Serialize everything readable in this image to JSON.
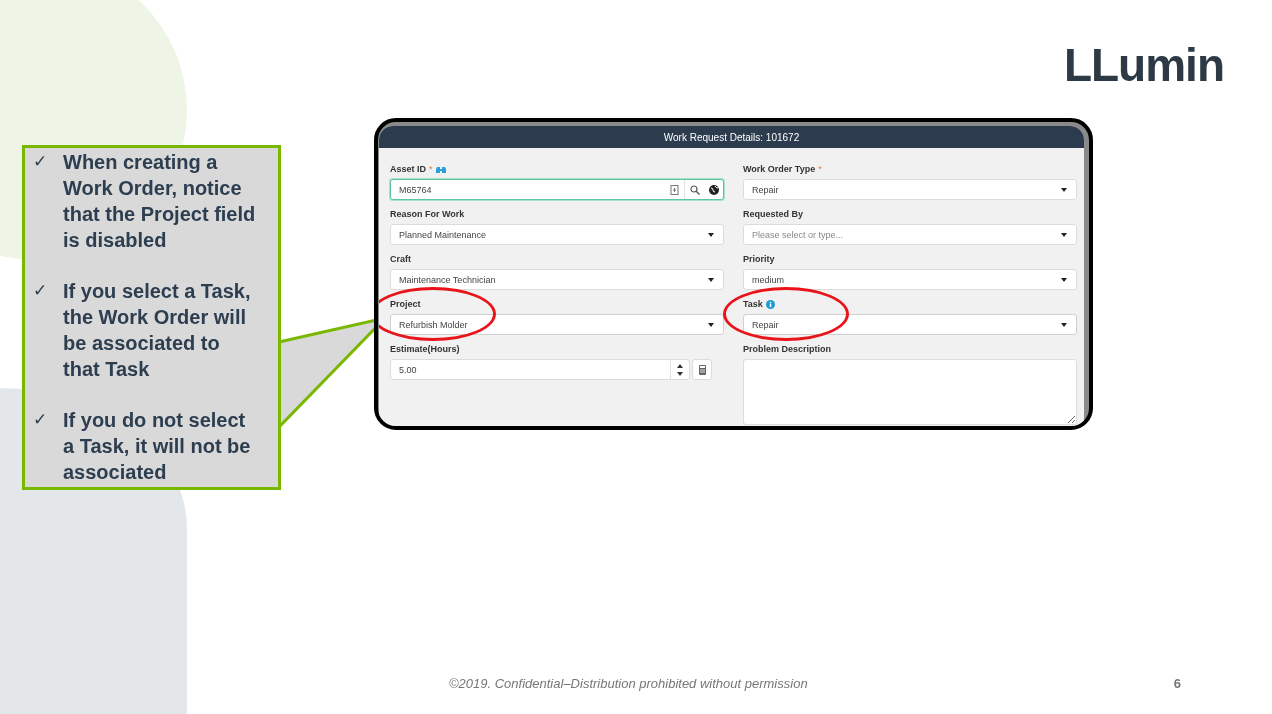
{
  "logo": {
    "text": "LLumin"
  },
  "callout": {
    "items": [
      {
        "check": "✓",
        "text": "When creating a Work Order, notice that the Project field is disabled"
      },
      {
        "check": "✓",
        "text": "If you select a Task, the Work Order will be associated to that Task"
      },
      {
        "check": "✓",
        "text": "If you do not select a Task, it will not be associated"
      }
    ]
  },
  "window": {
    "title": "Work Request Details: 101672",
    "columns": [
      {
        "fields": [
          {
            "kind": "lookup",
            "label": "Asset ID",
            "required_mark": "*",
            "label_icon": {
              "kind": "binoculars"
            },
            "value": "M65764",
            "focused": true,
            "highlighted": false
          },
          {
            "kind": "select",
            "label": "Reason For Work",
            "value": "Planned Maintenance",
            "focused": false,
            "highlighted": false
          },
          {
            "kind": "select",
            "label": "Craft",
            "value": "Maintenance Technician",
            "focused": false,
            "highlighted": false
          },
          {
            "kind": "select",
            "label": "Project",
            "value": "Refurbish Molder",
            "focused": false,
            "highlighted": true
          },
          {
            "kind": "number",
            "label": "Estimate(Hours)",
            "value": "5.00",
            "focused": false,
            "highlighted": false
          }
        ]
      },
      {
        "fields": [
          {
            "kind": "select",
            "label": "Work Order Type",
            "required_mark": "*",
            "value": "Repair",
            "focused": false,
            "highlighted": false
          },
          {
            "kind": "select",
            "label": "Requested By",
            "placeholder": "Please select or type...",
            "focused": false,
            "highlighted": false
          },
          {
            "kind": "select",
            "label": "Priority",
            "value": "medium",
            "focused": false,
            "highlighted": false
          },
          {
            "kind": "select",
            "label": "Task",
            "label_icon": {
              "kind": "info"
            },
            "value": "Repair",
            "focused": false,
            "highlighted": true
          },
          {
            "kind": "textarea",
            "label": "Problem Description",
            "focused": false,
            "highlighted": false
          }
        ]
      }
    ]
  },
  "footer": {
    "copyright": "©2019. Confidential–Distribution prohibited without permission",
    "page_number": "6"
  }
}
